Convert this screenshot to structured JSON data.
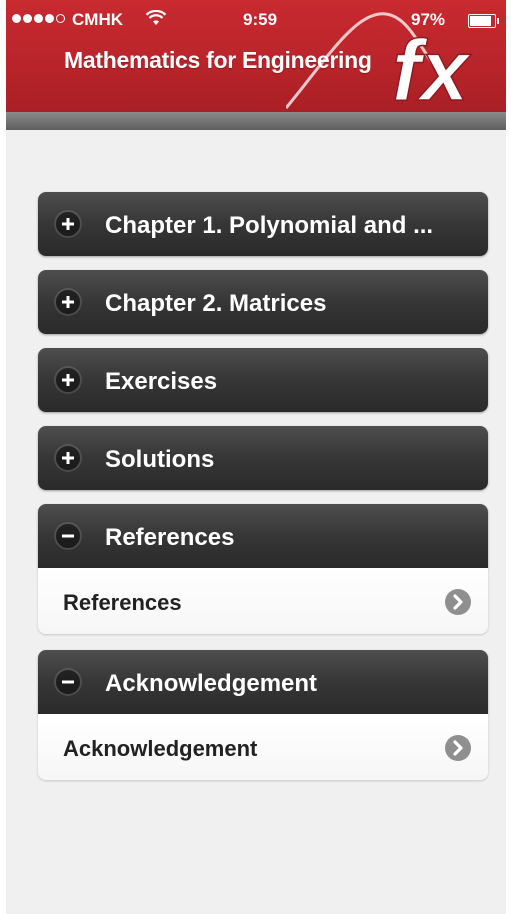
{
  "status_bar": {
    "carrier": "CMHK",
    "time": "9:59",
    "battery": "97%"
  },
  "header": {
    "title": "Mathematics for Engineering",
    "logo_text": "fx",
    "brand_color": "#b8242a"
  },
  "sections": [
    {
      "label": "Chapter 1. Polynomial and ...",
      "expanded": false,
      "icon": "plus-icon"
    },
    {
      "label": "Chapter 2. Matrices",
      "expanded": false,
      "icon": "plus-icon"
    },
    {
      "label": "Exercises",
      "expanded": false,
      "icon": "plus-icon"
    },
    {
      "label": "Solutions",
      "expanded": false,
      "icon": "plus-icon"
    },
    {
      "label": "References",
      "expanded": true,
      "icon": "minus-icon",
      "items": [
        {
          "label": "References",
          "icon": "chevron-right-icon"
        }
      ]
    },
    {
      "label": "Acknowledgement",
      "expanded": true,
      "icon": "minus-icon",
      "items": [
        {
          "label": "Acknowledgement",
          "icon": "chevron-right-icon"
        }
      ]
    }
  ]
}
